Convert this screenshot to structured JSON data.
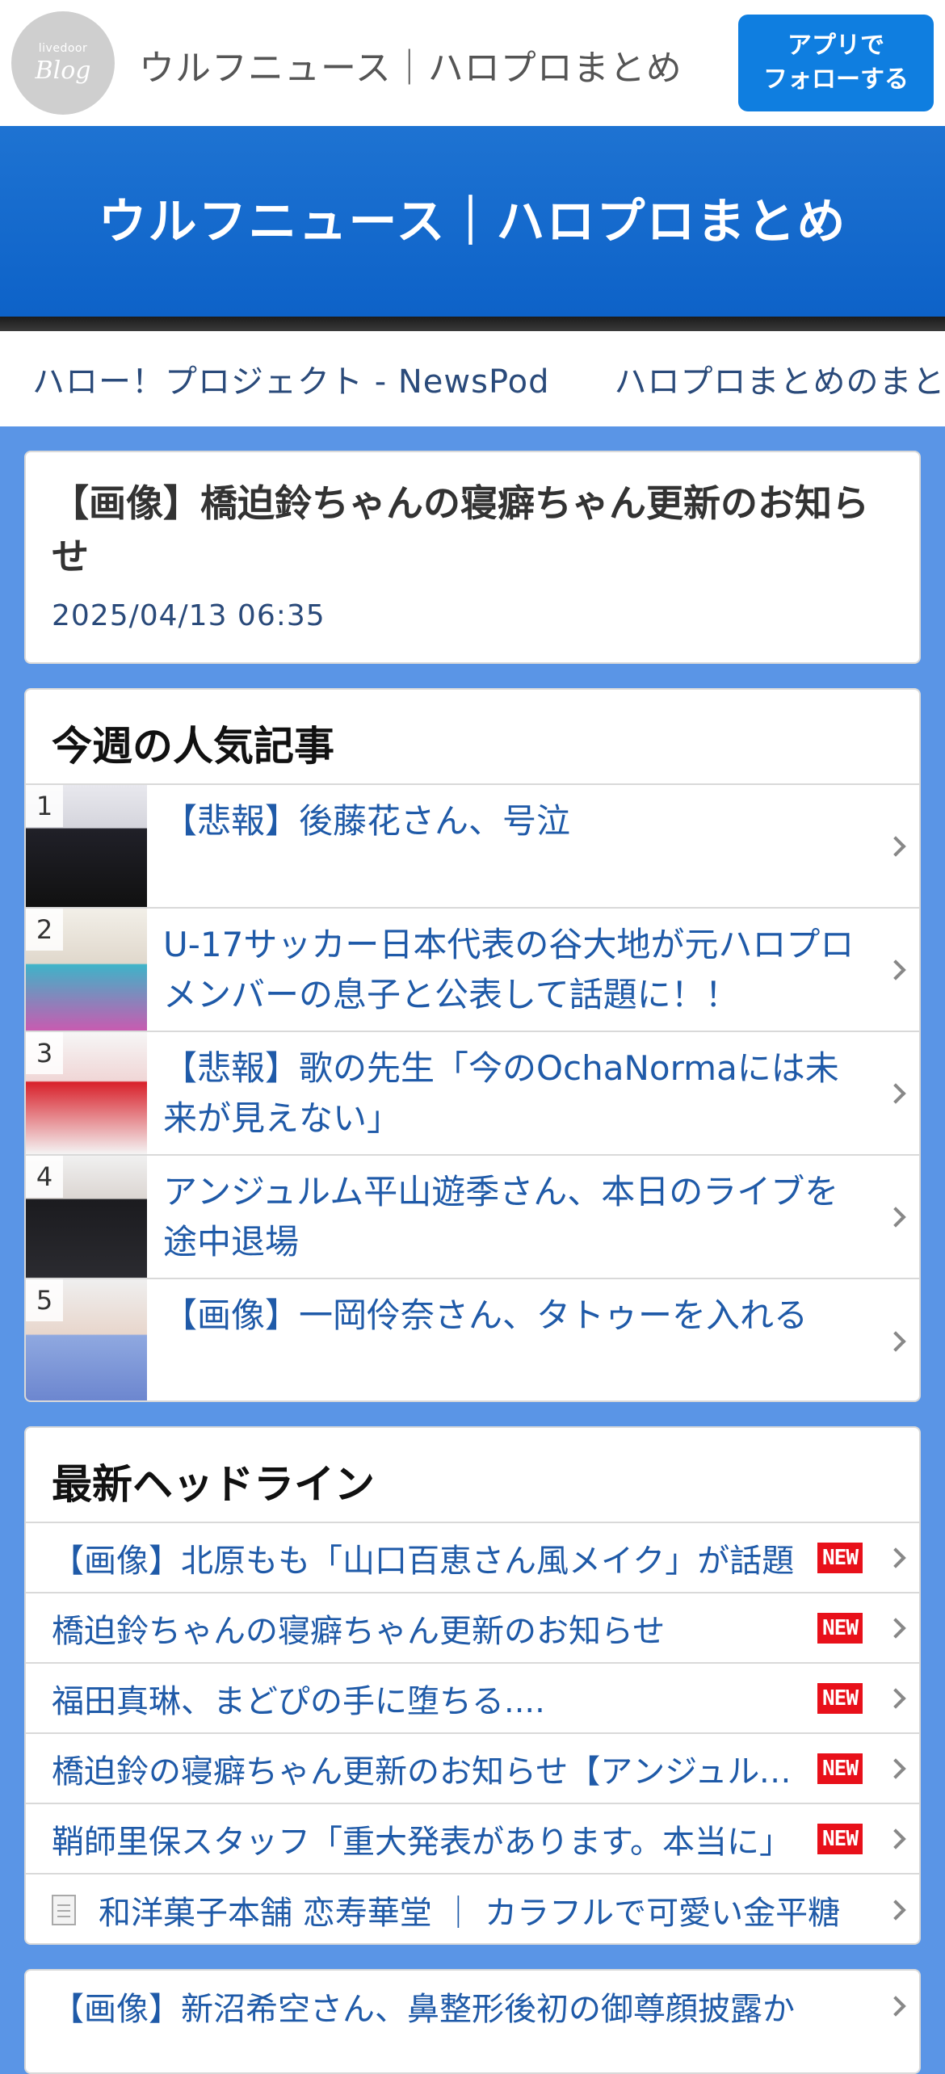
{
  "header": {
    "logo_small": "livedoor",
    "logo_big": "Blog",
    "site_name": "ウルフニュース｜ハロプロまとめ",
    "follow_line1": "アプリで",
    "follow_line2": "フォローする"
  },
  "banner": {
    "title": "ウルフニュース｜ハロプロまとめ"
  },
  "nav_links": [
    "ハロー！プロジェクト - NewsPod",
    "ハロプロまとめのまとめアンテナ"
  ],
  "article": {
    "title": "【画像】橋迫鈴ちゃんの寝癖ちゃん更新のお知らせ",
    "date": "2025/04/13 06:35"
  },
  "popular": {
    "title": "今週の人気記事",
    "items": [
      {
        "rank": "1",
        "text": "【悲報】後藤花さん、号泣",
        "thumb": "portrait-black-outfit"
      },
      {
        "rank": "2",
        "text": "U-17サッカー日本代表の谷大地が元ハロプロメンバーの息子と公表して話題に！！",
        "thumb": "portrait-soccer-jersey"
      },
      {
        "rank": "3",
        "text": "【悲報】歌の先生「今のOchaNormaには未来が見えない」",
        "thumb": "group-red-outfits"
      },
      {
        "rank": "4",
        "text": "アンジュルム平山遊季さん、本日のライブを途中退場",
        "thumb": "portrait-black-jacket"
      },
      {
        "rank": "5",
        "text": "【画像】一岡伶奈さん、タトゥーを入れる",
        "thumb": "portrait-blue-dress"
      }
    ]
  },
  "headlines": {
    "title": "最新ヘッドライン",
    "new_label": "NEW",
    "items": [
      {
        "text": "【画像】北原もも「山口百恵さん風メイク」が話題",
        "new": true
      },
      {
        "text": "橋迫鈴ちゃんの寝癖ちゃん更新のお知らせ",
        "new": true
      },
      {
        "text": "福田真琳、まどぴの手に堕ちる....",
        "new": true
      },
      {
        "text": "橋迫鈴の寝癖ちゃん更新のお知らせ【アンジュルム】",
        "new": true
      },
      {
        "text": "鞘師里保スタッフ「重大発表があります。本当に」",
        "new": true
      },
      {
        "text": "和洋菓子本舗 恋寿華堂 ｜ カラフルで可愛い金平糖",
        "new": false,
        "icon": "document-icon"
      }
    ]
  },
  "bottom": {
    "items": [
      {
        "text": "【画像】新沼希空さん、鼻整形後初の御尊顔披露か"
      }
    ]
  }
}
